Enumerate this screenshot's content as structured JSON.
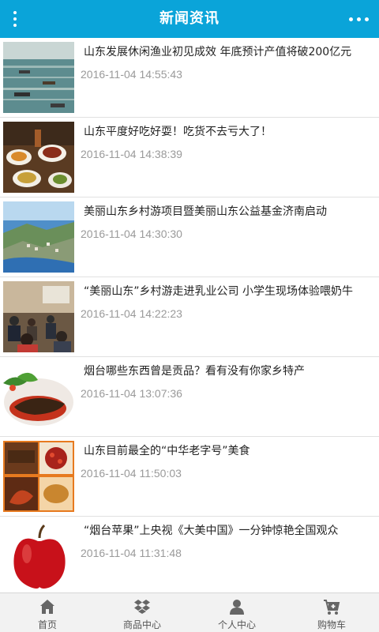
{
  "header": {
    "title": "新闻资讯"
  },
  "news": [
    {
      "title": "山东发展休闲渔业初见成效 年底预计产值将破200亿元",
      "date": "2016-11-04 14:55:43",
      "thumb": "harbor-fishing-boats"
    },
    {
      "title": "山东平度好吃好耍！吃货不去亏大了！",
      "date": "2016-11-04 14:38:39",
      "thumb": "food-banquet"
    },
    {
      "title": "美丽山东乡村游项目暨美丽山东公益基金济南启动",
      "date": "2016-11-04 14:30:30",
      "thumb": "coastal-town"
    },
    {
      "title": "“美丽山东”乡村游走进乳业公司 小学生现场体验喂奶牛",
      "date": "2016-11-04 14:22:23",
      "thumb": "meeting-room"
    },
    {
      "title": "烟台哪些东西曾是贡品？看有没有你家乡特产",
      "date": "2016-11-04 13:07:36",
      "thumb": "sea-cucumber-dish"
    },
    {
      "title": "山东目前最全的“中华老字号”美食",
      "date": "2016-11-04 11:50:03",
      "thumb": "dishes-collage"
    },
    {
      "title": "“烟台苹果”上央视《大美中国》一分钟惊艳全国观众",
      "date": "2016-11-04 11:31:48",
      "thumb": "red-apple"
    }
  ],
  "tabbar": [
    {
      "label": "首页",
      "icon": "home-icon"
    },
    {
      "label": "商品中心",
      "icon": "dropbox-icon"
    },
    {
      "label": "个人中心",
      "icon": "user-icon"
    },
    {
      "label": "购物车",
      "icon": "cart-icon"
    }
  ],
  "colors": {
    "header_bg": "#0aa4d9",
    "date_text": "#9a9a9a",
    "tabbar_bg": "#f2f2f2"
  }
}
